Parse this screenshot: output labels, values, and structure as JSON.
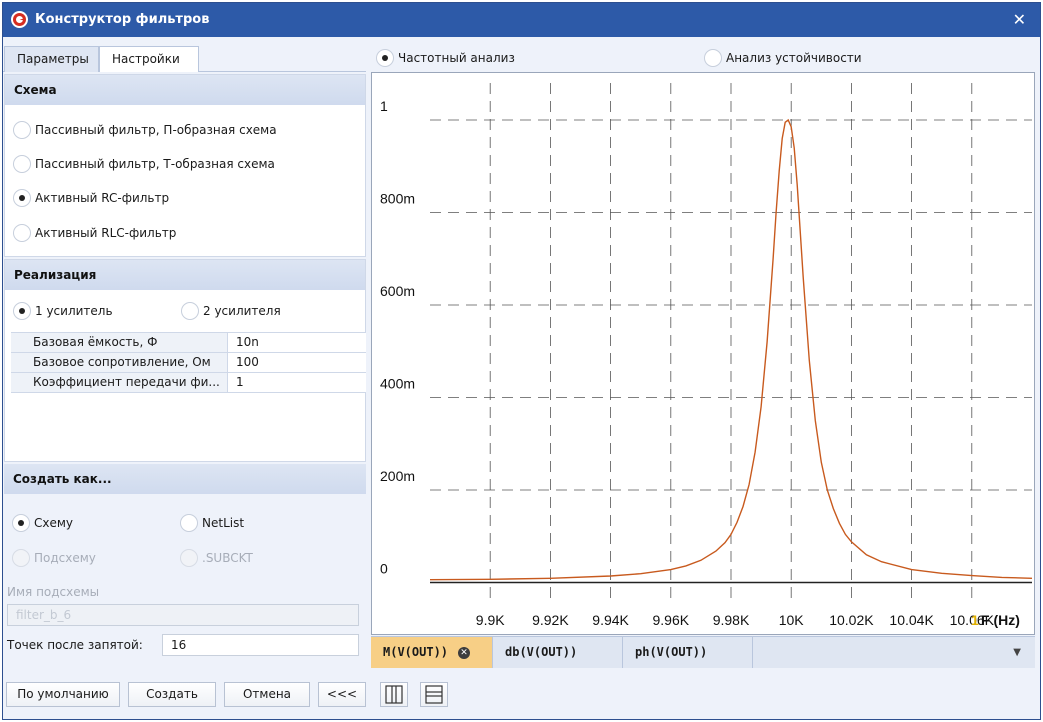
{
  "window": {
    "title": "Конструктор фильтров",
    "close_glyph": "✕"
  },
  "tabs": [
    {
      "label": "Параметры"
    },
    {
      "label": "Настройки"
    }
  ],
  "schema": {
    "heading": "Схема",
    "options": [
      {
        "label": "Пассивный фильтр, П-образная схема",
        "checked": false
      },
      {
        "label": "Пассивный фильтр, Т-образная схема",
        "checked": false
      },
      {
        "label": "Активный RC-фильтр",
        "checked": true
      },
      {
        "label": "Активный RLC-фильтр",
        "checked": false
      }
    ]
  },
  "realization": {
    "heading": "Реализация",
    "amp1": "1 усилитель",
    "amp2": "2 усилителя",
    "props": [
      {
        "key": "Базовая ёмкость, Ф",
        "value": "10n"
      },
      {
        "key": "Базовое сопротивление, Ом",
        "value": "100"
      },
      {
        "key": "Коэффициент передачи фи...",
        "value": "1"
      }
    ]
  },
  "create_as": {
    "heading": "Создать как...",
    "schema": "Схему",
    "netlist": "NetList",
    "subschema": "Подсхему",
    "subckt": ".SUBCKT",
    "subname_label": "Имя подсхемы",
    "subname_value": "filter_b_6",
    "precision_label": "Точек после запятой:",
    "precision_value": "16"
  },
  "buttons": {
    "defaults": "По умолчанию",
    "create": "Создать",
    "cancel": "Отмена",
    "collapse": "<<<"
  },
  "modes": {
    "freq": "Частотный анализ",
    "stability": "Анализ устойчивости"
  },
  "trace_tabs": [
    {
      "label": "M(V(OUT))"
    },
    {
      "label": "db(V(OUT))"
    },
    {
      "label": "ph(V(OUT))"
    }
  ],
  "colors": {
    "trace": "#c85a1e",
    "accent_tab": "#f7cf86",
    "titlebar": "#2d5aa8"
  },
  "chart_data": {
    "type": "line",
    "xlabel": "F (Hz)",
    "ylabel": "",
    "xlim": [
      9880,
      10080
    ],
    "ylim": [
      -0.04,
      1.08
    ],
    "x_ticks": [
      9900,
      9920,
      9940,
      9960,
      9980,
      10000,
      10020,
      10040,
      10060
    ],
    "x_tick_labels": [
      "9.9K",
      "9.92K",
      "9.94K",
      "9.96K",
      "9.98K",
      "10K",
      "10.02K",
      "10.04K",
      "10.06K"
    ],
    "last_tick_label": "1",
    "y_ticks": [
      0,
      0.2,
      0.4,
      0.6,
      0.8,
      1.0
    ],
    "y_tick_labels": [
      "0",
      "200m",
      "400m",
      "600m",
      "800m",
      "1"
    ],
    "grid": true,
    "series": [
      {
        "x": [
          9880,
          9900,
          9920,
          9940,
          9950,
          9960,
          9965,
          9970,
          9975,
          9978,
          9980,
          9982,
          9984,
          9986,
          9988,
          9990,
          9992,
          9994,
          9995,
          9996,
          9997,
          9998,
          9999,
          10000,
          10001,
          10002,
          10003,
          10004,
          10006,
          10008,
          10010,
          10012,
          10014,
          10016,
          10018,
          10020,
          10025,
          10030,
          10040,
          10050,
          10060,
          10070,
          10080
        ],
        "y": [
          0.006,
          0.007,
          0.009,
          0.014,
          0.019,
          0.028,
          0.036,
          0.048,
          0.068,
          0.086,
          0.104,
          0.13,
          0.164,
          0.212,
          0.282,
          0.38,
          0.52,
          0.7,
          0.8,
          0.89,
          0.96,
          0.995,
          1.0,
          0.985,
          0.94,
          0.86,
          0.76,
          0.66,
          0.48,
          0.35,
          0.26,
          0.2,
          0.16,
          0.128,
          0.104,
          0.088,
          0.06,
          0.045,
          0.028,
          0.02,
          0.015,
          0.011,
          0.009
        ]
      }
    ]
  }
}
